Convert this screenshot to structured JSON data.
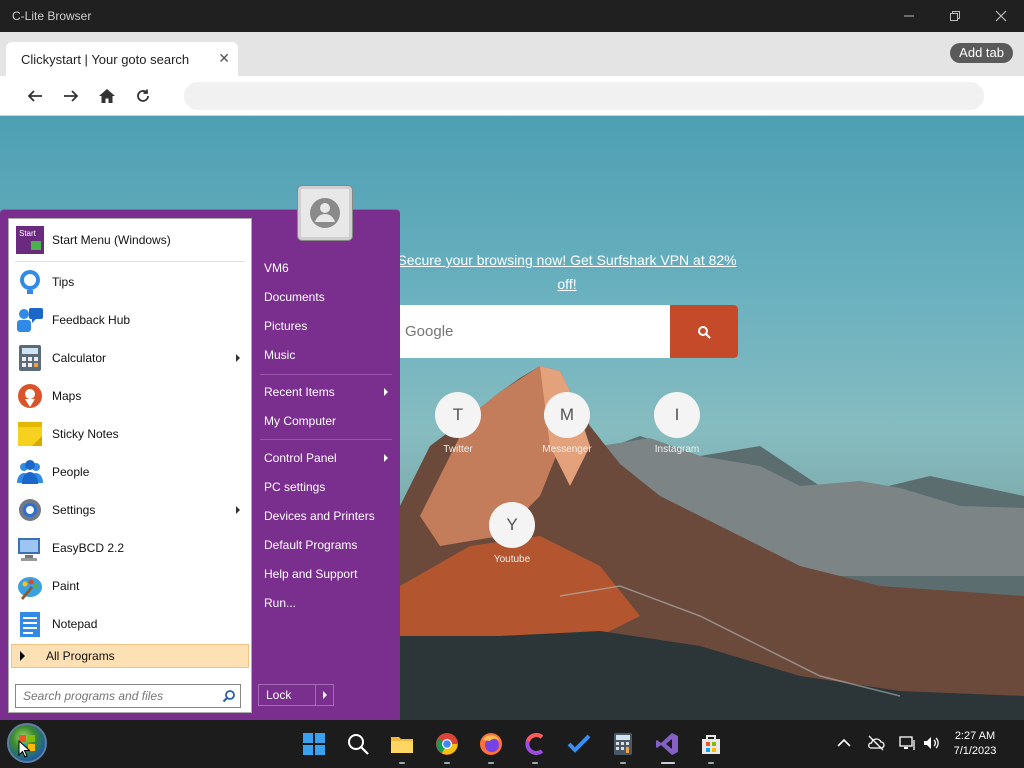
{
  "window": {
    "title": "C-Lite Browser"
  },
  "tabs": [
    {
      "label": "Clickystart | Your goto search"
    }
  ],
  "browser": {
    "add_tab_label": "Add tab",
    "address_value": ""
  },
  "page": {
    "promo": "Secure your browsing now! Get Surfshark VPN at 82% off!",
    "search_placeholder": "Google",
    "shortcuts": [
      {
        "letter": "T",
        "label": "Twitter"
      },
      {
        "letter": "M",
        "label": "Messenger"
      },
      {
        "letter": "I",
        "label": "Instagram"
      },
      {
        "letter": "Y",
        "label": "Youtube"
      }
    ]
  },
  "start_menu": {
    "header": {
      "label": "Start Menu (Windows)",
      "icon_text": "Start"
    },
    "programs": [
      {
        "label": "Tips",
        "icon": "tips-icon",
        "submenu": false
      },
      {
        "label": "Feedback Hub",
        "icon": "feedback-hub-icon",
        "submenu": false
      },
      {
        "label": "Calculator",
        "icon": "calculator-icon",
        "submenu": true
      },
      {
        "label": "Maps",
        "icon": "maps-icon",
        "submenu": false
      },
      {
        "label": "Sticky Notes",
        "icon": "sticky-notes-icon",
        "submenu": false
      },
      {
        "label": "People",
        "icon": "people-icon",
        "submenu": false
      },
      {
        "label": "Settings",
        "icon": "settings-icon",
        "submenu": true
      },
      {
        "label": "EasyBCD 2.2",
        "icon": "easybcd-icon",
        "submenu": false
      },
      {
        "label": "Paint",
        "icon": "paint-icon",
        "submenu": false
      },
      {
        "label": "Notepad",
        "icon": "notepad-icon",
        "submenu": false
      }
    ],
    "all_programs": "All Programs",
    "search_placeholder": "Search programs and files",
    "right_items": [
      {
        "label": "VM6",
        "submenu": false
      },
      {
        "label": "Documents",
        "submenu": false
      },
      {
        "label": "Pictures",
        "submenu": false
      },
      {
        "label": "Music",
        "submenu": false
      },
      {
        "label": "Recent Items",
        "submenu": true
      },
      {
        "label": "My Computer",
        "submenu": false
      },
      {
        "label": "Control Panel",
        "submenu": true
      },
      {
        "label": "PC settings",
        "submenu": false
      },
      {
        "label": "Devices and Printers",
        "submenu": false
      },
      {
        "label": "Default Programs",
        "submenu": false
      },
      {
        "label": "Help and Support",
        "submenu": false
      },
      {
        "label": "Run...",
        "submenu": false
      }
    ],
    "lock_label": "Lock"
  },
  "taskbar": {
    "apps": [
      "windows-logo-icon",
      "search-icon",
      "file-explorer-icon",
      "chrome-icon",
      "firefox-icon",
      "c-lite-icon",
      "todo-icon",
      "calculator-icon",
      "visual-studio-icon",
      "store-icon"
    ],
    "clock": {
      "time": "2:27 AM",
      "date": "7/1/2023"
    }
  },
  "colors": {
    "start_menu": "#7a2f8f",
    "search_button": "#c54a2a",
    "all_programs_bg": "#fde0b4"
  }
}
